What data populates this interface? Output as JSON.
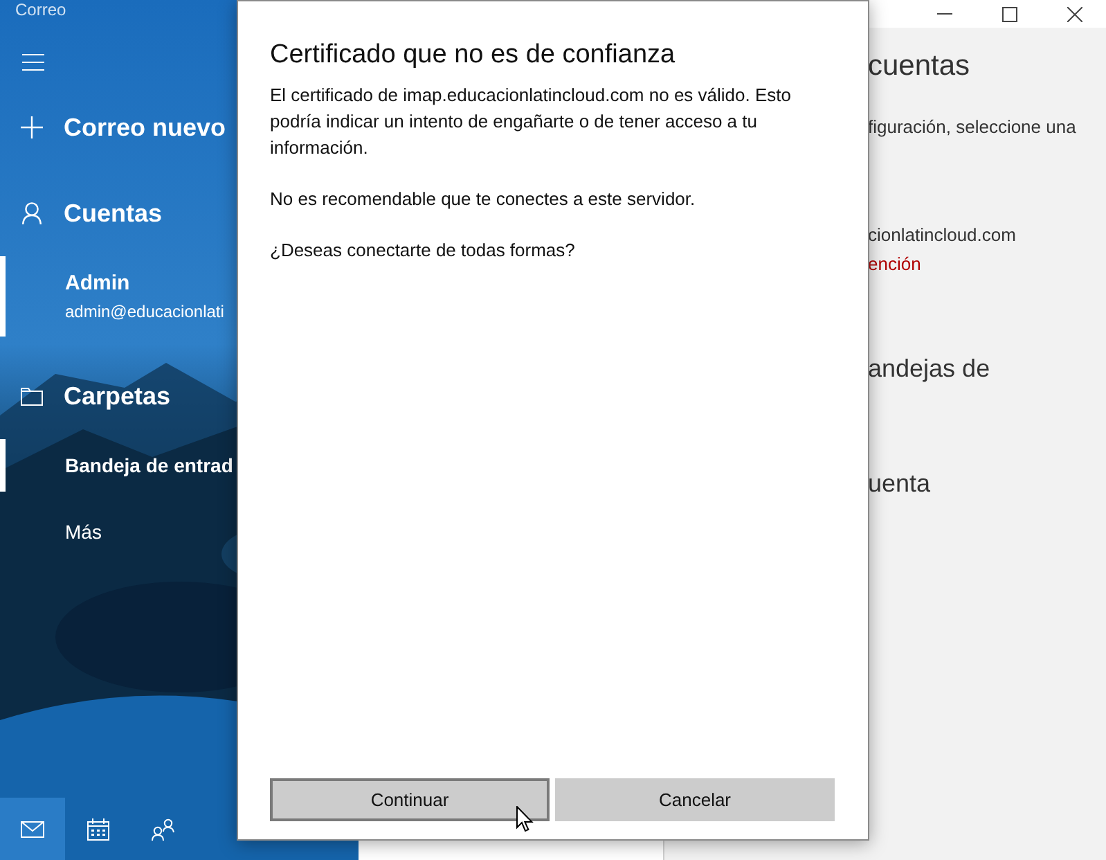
{
  "app_title": "Correo",
  "nav": {
    "items": [
      {
        "kind": "action",
        "label": "Correo nuevo"
      },
      {
        "kind": "header",
        "label": "Cuentas"
      },
      {
        "kind": "account",
        "name": "Admin",
        "email": "admin@educacionlati",
        "selected": true
      },
      {
        "kind": "header",
        "label": "Carpetas"
      },
      {
        "kind": "folder",
        "label": "Bandeja de entrad",
        "selected": true
      },
      {
        "kind": "folder",
        "label": "Más",
        "selected": false
      }
    ],
    "bottom": [
      {
        "selected": true
      },
      {
        "selected": false
      },
      {
        "selected": false
      }
    ]
  },
  "settings": {
    "title": "cuentas",
    "lines": [
      {
        "kind": "text",
        "text": "figuración, seleccione una"
      },
      {
        "kind": "account",
        "text": "cionlatincloud.com"
      },
      {
        "kind": "warning",
        "text": "ención"
      },
      {
        "kind": "heading",
        "text": "andejas de"
      },
      {
        "kind": "heading",
        "text": "uenta"
      }
    ]
  },
  "dialog": {
    "title": "Certificado que no es de confianza",
    "paragraphs": [
      "El certificado de imap.educacionlatincloud.com no es válido. Esto podría indicar un intento de engañarte o de tener acceso a tu información.",
      "No es recomendable que te conectes a este servidor.",
      "¿Deseas conectarte de todas formas?"
    ],
    "buttons": [
      {
        "label": "Continuar",
        "focused": true
      },
      {
        "label": "Cancelar",
        "focused": false
      }
    ]
  }
}
